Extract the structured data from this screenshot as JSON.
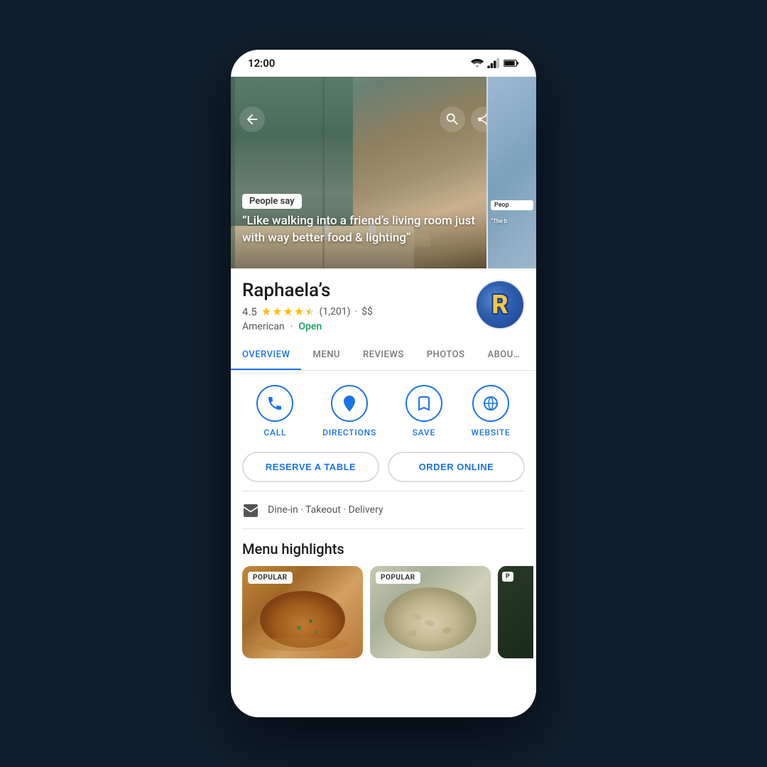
{
  "statusBar": {
    "time": "12:00",
    "icons": {
      "wifi": "wifi",
      "signal": "signal",
      "battery": "battery"
    }
  },
  "hero": {
    "back_aria": "back",
    "search_aria": "search",
    "share_aria": "share",
    "more_aria": "more options",
    "people_say_label": "People say",
    "quote": "“Like walking into a friend’s living room just with way better food & lighting”",
    "second_people_say_label": "Peop",
    "second_quote": "“The b"
  },
  "restaurant": {
    "name": "Raphaela’s",
    "rating": "4.5",
    "review_count": "(1,201)",
    "price_range": "$$",
    "cuisine": "American",
    "open_status": "Open",
    "logo_letter": "R"
  },
  "tabs": [
    {
      "label": "OVERVIEW",
      "active": true
    },
    {
      "label": "MENU",
      "active": false
    },
    {
      "label": "REVIEWS",
      "active": false
    },
    {
      "label": "PHOTOS",
      "active": false
    },
    {
      "label": "ABOU…",
      "active": false
    }
  ],
  "actions": [
    {
      "label": "CALL",
      "icon": "phone-icon"
    },
    {
      "label": "DIRECTIONS",
      "icon": "directions-icon"
    },
    {
      "label": "SAVE",
      "icon": "save-icon"
    },
    {
      "label": "WEBSITE",
      "icon": "website-icon"
    }
  ],
  "cta_buttons": [
    {
      "label": "RESERVE A TABLE"
    },
    {
      "label": "ORDER ONLINE"
    }
  ],
  "service_options": {
    "text": "Dine-in · Takeout · Delivery"
  },
  "menu_highlights": {
    "section_title": "Menu highlights",
    "items": [
      {
        "badge": "POPULAR"
      },
      {
        "badge": "POPULAR"
      },
      {
        "badge": "P"
      }
    ]
  }
}
